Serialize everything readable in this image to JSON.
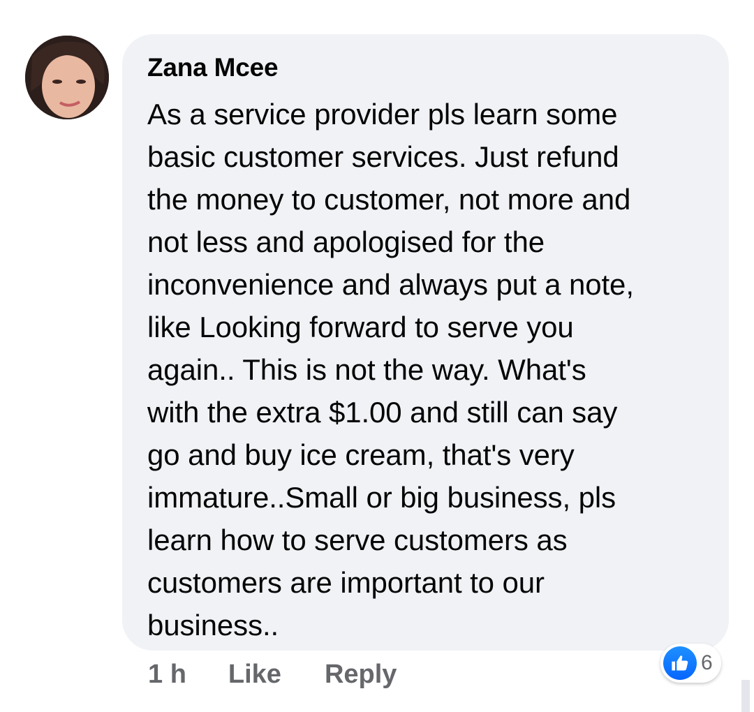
{
  "comment": {
    "author": "Zana Mcee",
    "text": "As a service provider pls learn some\nbasic customer services. Just refund\nthe money to customer, not more and\nnot less and apologised for the\ninconvenience and always put a note,\nlike Looking forward to serve you\nagain.. This is not the way. What's\nwith the extra $1.00 and still can say\ngo and buy ice cream, that's very\nimmature..Small or big business, pls\nlearn how to serve customers as\ncustomers are important to our\nbusiness..",
    "reaction": {
      "icon": "thumbs-up-icon",
      "count": "6",
      "color": "#0866ff"
    }
  },
  "actions": {
    "timestamp": "1 h",
    "like_label": "Like",
    "reply_label": "Reply"
  },
  "colors": {
    "bubble": "#f0f2f5",
    "text": "#050505",
    "secondary_text": "#65676b"
  }
}
